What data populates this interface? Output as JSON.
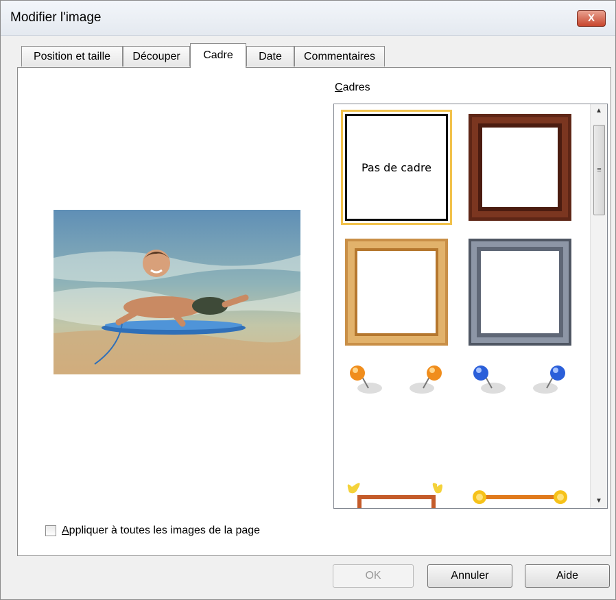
{
  "window": {
    "title": "Modifier l'image",
    "close_glyph": "X"
  },
  "tabs": [
    {
      "label": "Position et taille"
    },
    {
      "label": "Découper"
    },
    {
      "label": "Cadre",
      "active": true
    },
    {
      "label": "Date"
    },
    {
      "label": "Commentaires"
    }
  ],
  "frames": {
    "label_first": "C",
    "label_rest": "adres",
    "selected": "Pas de cadre",
    "no_frame_label": "Pas de cadre",
    "items": [
      "no-frame",
      "dark-wood-frame",
      "light-wood-frame",
      "metal-frame",
      "orange-pins",
      "blue-pins",
      "butterfly-frame",
      "sun-frame"
    ]
  },
  "preview": {
    "image": "child-on-bodyboard-beach-photo"
  },
  "apply_all": {
    "label_first": "A",
    "label_rest": "ppliquer à toutes les images de la page",
    "checked": false
  },
  "buttons": {
    "ok": "OK",
    "cancel": "Annuler",
    "help": "Aide"
  },
  "colors": {
    "selection": "#f2c24b",
    "accent_close": "#c7462e"
  }
}
